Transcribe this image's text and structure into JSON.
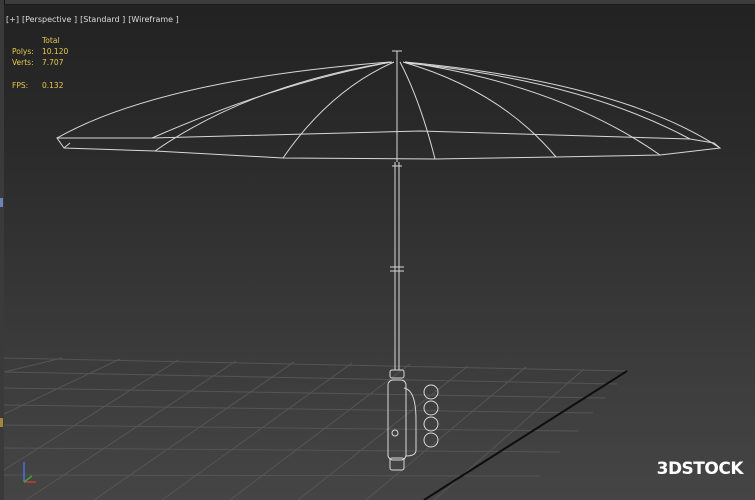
{
  "viewport": {
    "labels": [
      "[+]",
      "[Perspective ]",
      "[Standard ]",
      "[Wireframe ]"
    ]
  },
  "stats": {
    "header": "Total",
    "polys_label": "Polys:",
    "polys_value": "10.120",
    "verts_label": "Verts:",
    "verts_value": "7.707",
    "fps_label": "FPS:",
    "fps_value": "0.132"
  },
  "watermark": {
    "text": "3DSTOCK"
  },
  "colors": {
    "stats_text": "#e7c94e",
    "wire": "#d8d8d8",
    "grid": "#555555",
    "grid_dark": "#0e0e0e"
  },
  "icons": [
    "axis-gizmo-icon"
  ]
}
